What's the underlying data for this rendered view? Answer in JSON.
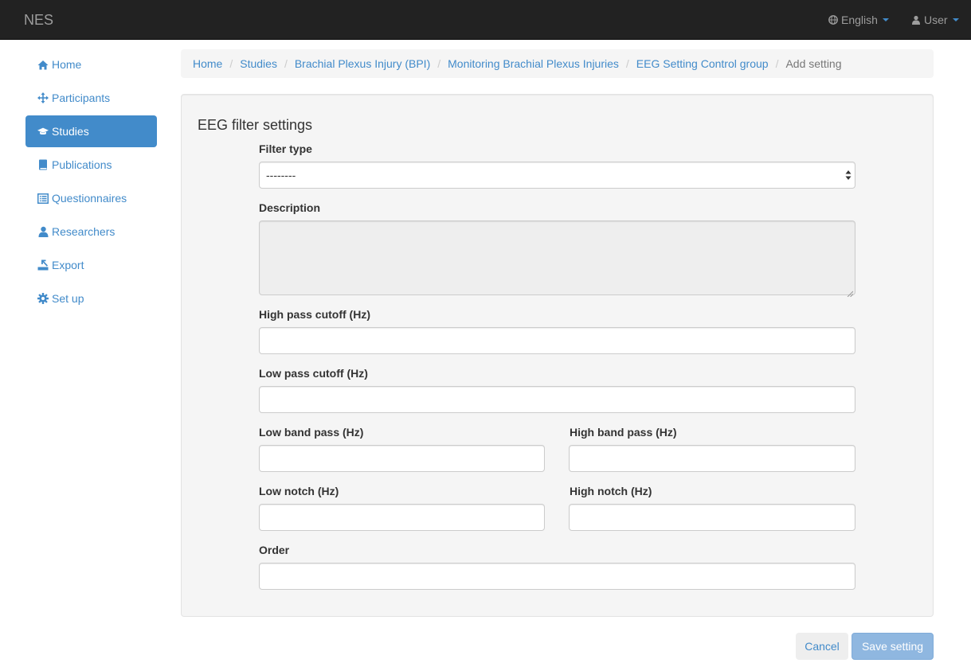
{
  "navbar": {
    "brand": "NES",
    "language": "English",
    "user": "User"
  },
  "sidebar": {
    "items": [
      {
        "label": "Home",
        "icon": "home-icon"
      },
      {
        "label": "Participants",
        "icon": "move-icon"
      },
      {
        "label": "Studies",
        "icon": "education-icon",
        "active": true
      },
      {
        "label": "Publications",
        "icon": "book-icon"
      },
      {
        "label": "Questionnaires",
        "icon": "list-alt-icon"
      },
      {
        "label": "Researchers",
        "icon": "user-icon"
      },
      {
        "label": "Export",
        "icon": "export-icon"
      },
      {
        "label": "Set up",
        "icon": "cog-icon"
      }
    ]
  },
  "breadcrumb": {
    "items": [
      "Home",
      "Studies",
      "Brachial Plexus Injury (BPI)",
      "Monitoring Brachial Plexus Injuries",
      "EEG Setting Control group"
    ],
    "current": "Add setting"
  },
  "form": {
    "title": "EEG filter settings",
    "filter_type_label": "Filter type",
    "filter_type_value": "--------",
    "description_label": "Description",
    "high_pass_label": "High pass cutoff (Hz)",
    "low_pass_label": "Low pass cutoff (Hz)",
    "low_band_label": "Low band pass (Hz)",
    "high_band_label": "High band pass (Hz)",
    "low_notch_label": "Low notch (Hz)",
    "high_notch_label": "High notch (Hz)",
    "order_label": "Order"
  },
  "actions": {
    "cancel": "Cancel",
    "save": "Save setting"
  },
  "colors": {
    "navbar_bg": "#222222",
    "accent": "#428bca",
    "panel_bg": "#f5f5f5",
    "save_button_bg": "#8fb7e0"
  }
}
